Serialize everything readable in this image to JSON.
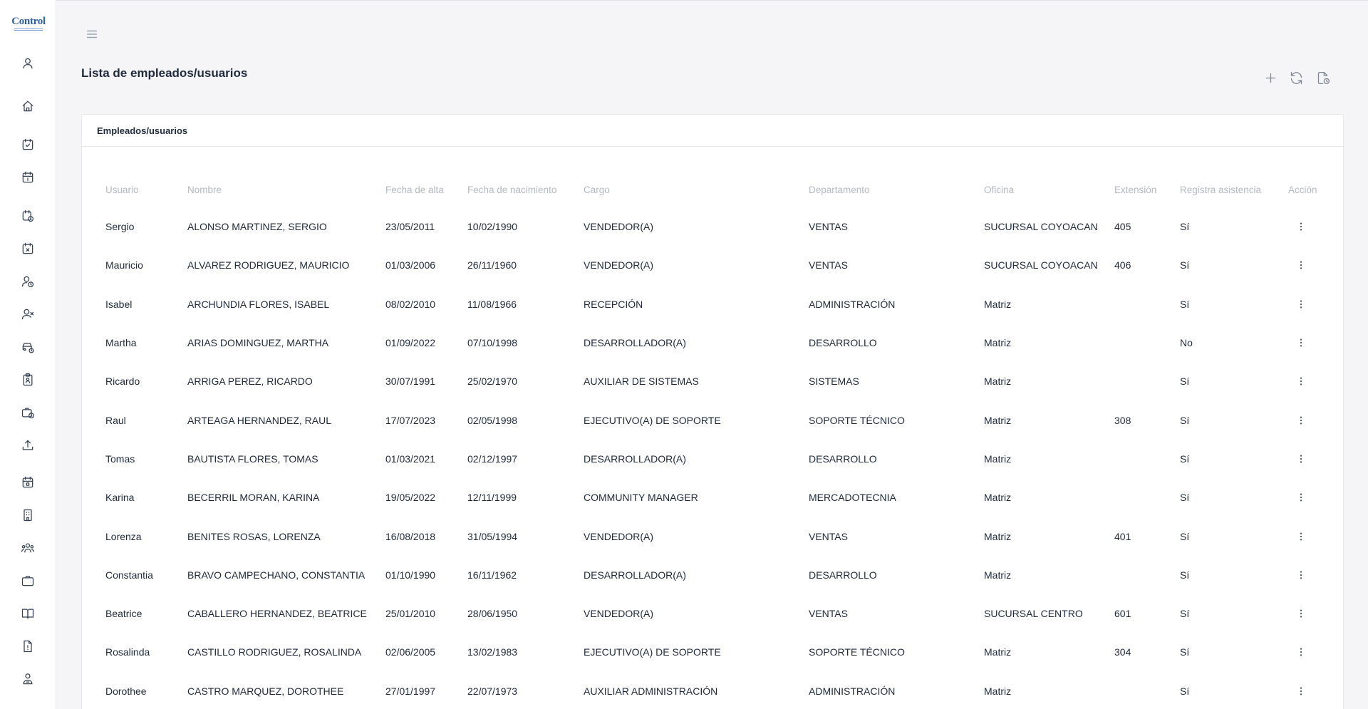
{
  "app": {
    "logo_text": "Control"
  },
  "sidebar": {
    "icons": [
      "user-icon",
      "home-icon",
      "calendar-check-icon",
      "calendar-one-icon",
      "calendar-clock-icon",
      "calendar-x-icon",
      "user-clock-icon",
      "user-x-icon",
      "car-clock-icon",
      "clipboard-user-icon",
      "briefcase-clock-icon",
      "upload-icon",
      "calendar-event-icon",
      "building-icon",
      "users-group-icon",
      "briefcase-icon",
      "book-icon",
      "document-alert-icon",
      "user-badge-icon"
    ]
  },
  "page": {
    "title": "Lista de empleados/usuarios"
  },
  "toolbar": {
    "add": "plus-icon",
    "refresh": "refresh-icon",
    "export": "file-clock-icon"
  },
  "card": {
    "title": "Empleados/usuarios"
  },
  "table": {
    "columns": [
      "Usuario",
      "Nombre",
      "Fecha de alta",
      "Fecha de nacimiento",
      "Cargo",
      "Departamento",
      "Oficina",
      "Extensión",
      "Registra asistencia",
      "Acción"
    ],
    "rows": [
      {
        "usuario": "Sergio",
        "nombre": "ALONSO MARTINEZ, SERGIO",
        "alta": "23/05/2011",
        "nacimiento": "10/02/1990",
        "cargo": "VENDEDOR(A)",
        "departamento": "VENTAS",
        "oficina": "SUCURSAL COYOACAN",
        "extension": "405",
        "asistencia": "Sí"
      },
      {
        "usuario": "Mauricio",
        "nombre": "ALVAREZ RODRIGUEZ, MAURICIO",
        "alta": "01/03/2006",
        "nacimiento": "26/11/1960",
        "cargo": "VENDEDOR(A)",
        "departamento": "VENTAS",
        "oficina": "SUCURSAL COYOACAN",
        "extension": "406",
        "asistencia": "Sí"
      },
      {
        "usuario": "Isabel",
        "nombre": "ARCHUNDIA FLORES, ISABEL",
        "alta": "08/02/2010",
        "nacimiento": "11/08/1966",
        "cargo": "RECEPCIÓN",
        "departamento": "ADMINISTRACIÓN",
        "oficina": "Matriz",
        "extension": "",
        "asistencia": "Sí"
      },
      {
        "usuario": "Martha",
        "nombre": "ARIAS DOMINGUEZ, MARTHA",
        "alta": "01/09/2022",
        "nacimiento": "07/10/1998",
        "cargo": "DESARROLLADOR(A)",
        "departamento": "DESARROLLO",
        "oficina": "Matriz",
        "extension": "",
        "asistencia": "No"
      },
      {
        "usuario": "Ricardo",
        "nombre": "ARRIGA PEREZ, RICARDO",
        "alta": "30/07/1991",
        "nacimiento": "25/02/1970",
        "cargo": "AUXILIAR DE SISTEMAS",
        "departamento": "SISTEMAS",
        "oficina": "Matriz",
        "extension": "",
        "asistencia": "Sí"
      },
      {
        "usuario": "Raul",
        "nombre": "ARTEAGA HERNANDEZ, RAUL",
        "alta": "17/07/2023",
        "nacimiento": "02/05/1998",
        "cargo": "EJECUTIVO(A) DE SOPORTE",
        "departamento": "SOPORTE TÉCNICO",
        "oficina": "Matriz",
        "extension": "308",
        "asistencia": "Sí"
      },
      {
        "usuario": "Tomas",
        "nombre": "BAUTISTA FLORES, TOMAS",
        "alta": "01/03/2021",
        "nacimiento": "02/12/1997",
        "cargo": "DESARROLLADOR(A)",
        "departamento": "DESARROLLO",
        "oficina": "Matriz",
        "extension": "",
        "asistencia": "Sí"
      },
      {
        "usuario": "Karina",
        "nombre": "BECERRIL MORAN, KARINA",
        "alta": "19/05/2022",
        "nacimiento": "12/11/1999",
        "cargo": "COMMUNITY MANAGER",
        "departamento": "MERCADOTECNIA",
        "oficina": "Matriz",
        "extension": "",
        "asistencia": "Sí"
      },
      {
        "usuario": "Lorenza",
        "nombre": "BENITES ROSAS, LORENZA",
        "alta": "16/08/2018",
        "nacimiento": "31/05/1994",
        "cargo": "VENDEDOR(A)",
        "departamento": "VENTAS",
        "oficina": "Matriz",
        "extension": "401",
        "asistencia": "Sí"
      },
      {
        "usuario": "Constantia",
        "nombre": "BRAVO CAMPECHANO, CONSTANTIA",
        "alta": "01/10/1990",
        "nacimiento": "16/11/1962",
        "cargo": "DESARROLLADOR(A)",
        "departamento": "DESARROLLO",
        "oficina": "Matriz",
        "extension": "",
        "asistencia": "Sí"
      },
      {
        "usuario": "Beatrice",
        "nombre": "CABALLERO HERNANDEZ, BEATRICE",
        "alta": "25/01/2010",
        "nacimiento": "28/06/1950",
        "cargo": "VENDEDOR(A)",
        "departamento": "VENTAS",
        "oficina": "SUCURSAL CENTRO",
        "extension": "601",
        "asistencia": "Sí"
      },
      {
        "usuario": "Rosalinda",
        "nombre": "CASTILLO RODRIGUEZ, ROSALINDA",
        "alta": "02/06/2005",
        "nacimiento": "13/02/1983",
        "cargo": "EJECUTIVO(A) DE SOPORTE",
        "departamento": "SOPORTE TÉCNICO",
        "oficina": "Matriz",
        "extension": "304",
        "asistencia": "Sí"
      },
      {
        "usuario": "Dorothee",
        "nombre": "CASTRO MARQUEZ, DOROTHEE",
        "alta": "27/01/1997",
        "nacimiento": "22/07/1973",
        "cargo": "AUXILIAR ADMINISTRACIÓN",
        "departamento": "ADMINISTRACIÓN",
        "oficina": "Matriz",
        "extension": "",
        "asistencia": "Sí"
      }
    ]
  }
}
